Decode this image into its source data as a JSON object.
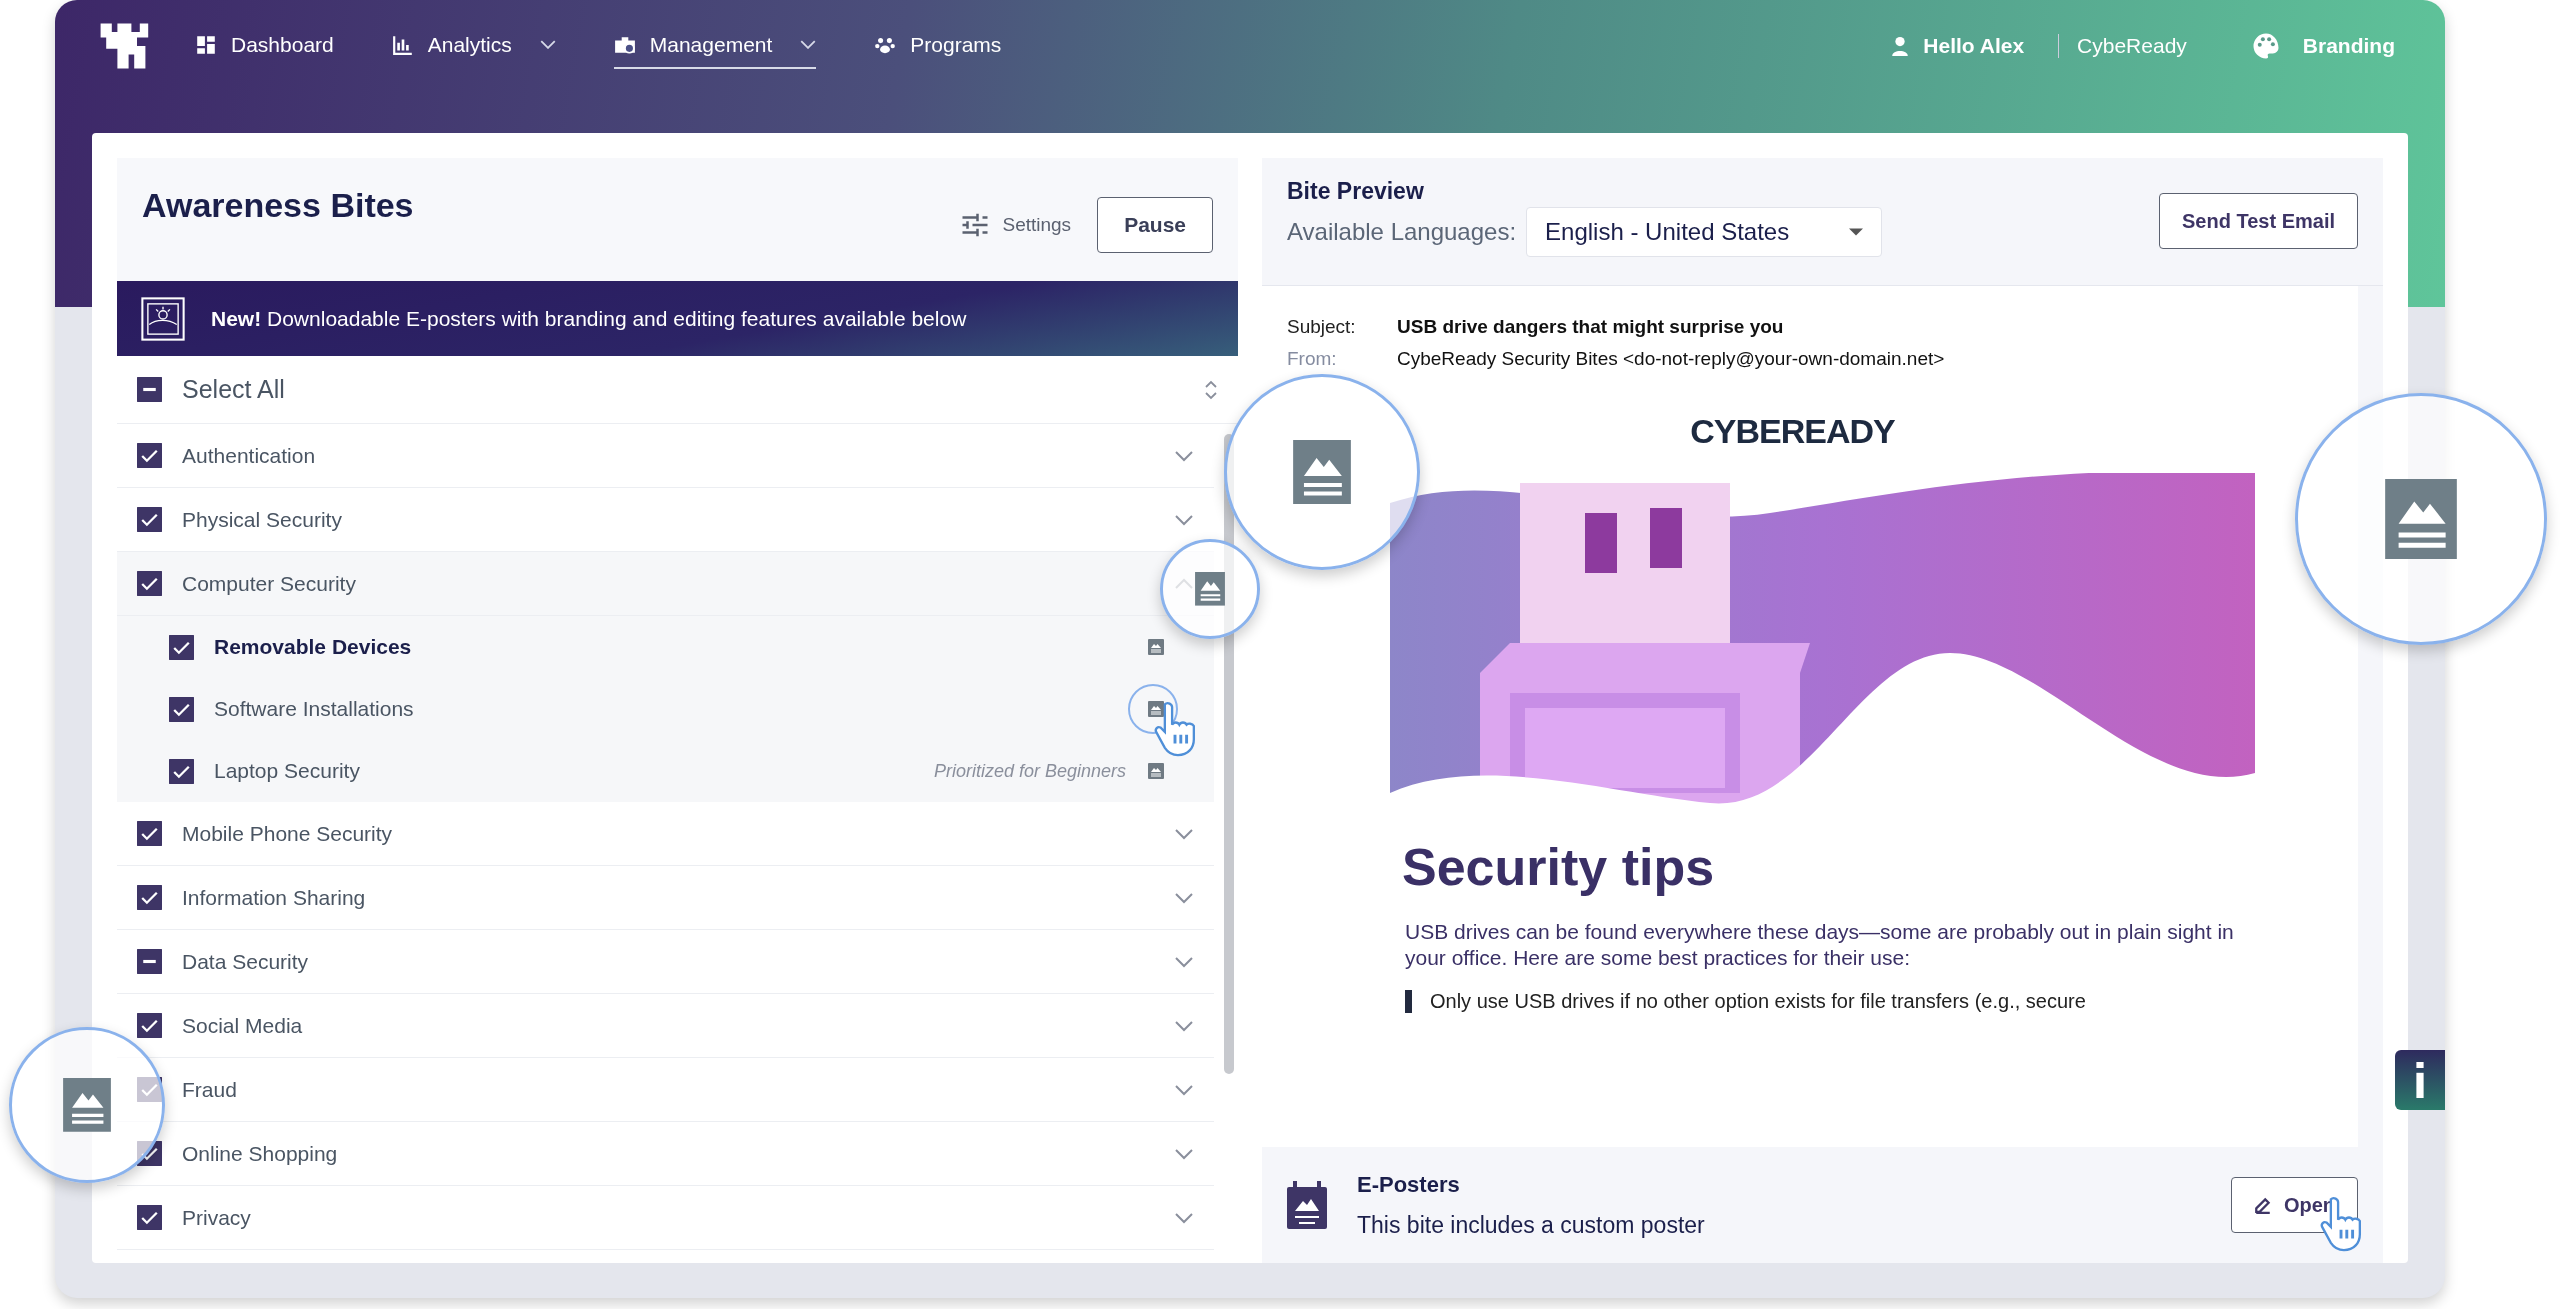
{
  "nav": {
    "items": [
      {
        "label": "Dashboard",
        "dropdown": false,
        "selected": false
      },
      {
        "label": "Analytics",
        "dropdown": true,
        "selected": false
      },
      {
        "label": "Management",
        "dropdown": true,
        "selected": true
      },
      {
        "label": "Programs",
        "dropdown": false,
        "selected": false
      }
    ],
    "user": "Hello Alex",
    "org": "CybeReady",
    "branding": "Branding"
  },
  "bites": {
    "title": "Awareness Bites",
    "settings": "Settings",
    "pause": "Pause",
    "banner": "**New!** Downloadable E-posters with branding and editing features available below",
    "select_all": {
      "label": "Select All",
      "checked": true,
      "partial": true
    },
    "categories": [
      {
        "label": "Authentication",
        "checked": true,
        "partial": false,
        "expanded": false
      },
      {
        "label": "Physical Security",
        "checked": true,
        "partial": false,
        "expanded": false
      },
      {
        "label": "Computer Security",
        "checked": true,
        "partial": false,
        "expanded": true,
        "children": [
          {
            "label": "Removable Devices",
            "checked": true,
            "selected": true
          },
          {
            "label": "Software Installations",
            "checked": true,
            "selected": false
          },
          {
            "label": "Laptop Security",
            "checked": true,
            "selected": false,
            "note": "Prioritized for Beginners"
          }
        ]
      },
      {
        "label": "Mobile Phone Security",
        "checked": true,
        "partial": false,
        "expanded": false
      },
      {
        "label": "Information Sharing",
        "checked": true,
        "partial": false,
        "expanded": false
      },
      {
        "label": "Data Security",
        "checked": true,
        "partial": true,
        "expanded": false
      },
      {
        "label": "Social Media",
        "checked": true,
        "partial": false,
        "expanded": false
      },
      {
        "label": "Fraud",
        "checked": true,
        "partial": false,
        "expanded": false
      },
      {
        "label": "Online Shopping",
        "checked": true,
        "partial": false,
        "expanded": false
      },
      {
        "label": "Privacy",
        "checked": true,
        "partial": false,
        "expanded": false
      }
    ]
  },
  "preview": {
    "title": "Bite Preview",
    "languages_label": "Available Languages:",
    "language": "English - United States",
    "send_test": "Send Test Email",
    "subject_label": "Subject:",
    "subject": "USB drive dangers that might surprise you",
    "from_label": "From:",
    "from": "CybeReady Security Bites <do-not-reply@your-own-domain.net>",
    "logo": "CYBEREADY",
    "heading": "Security tips",
    "body": "USB drives can be found everywhere these days—some are probably out in plain sight in your office. Here are some best practices for their use:",
    "tip": "Only use USB drives if no other option exists for file transfers (e.g., secure"
  },
  "eposters": {
    "title": "E-Posters",
    "text": "This bite includes a custom poster",
    "open": "Open"
  }
}
